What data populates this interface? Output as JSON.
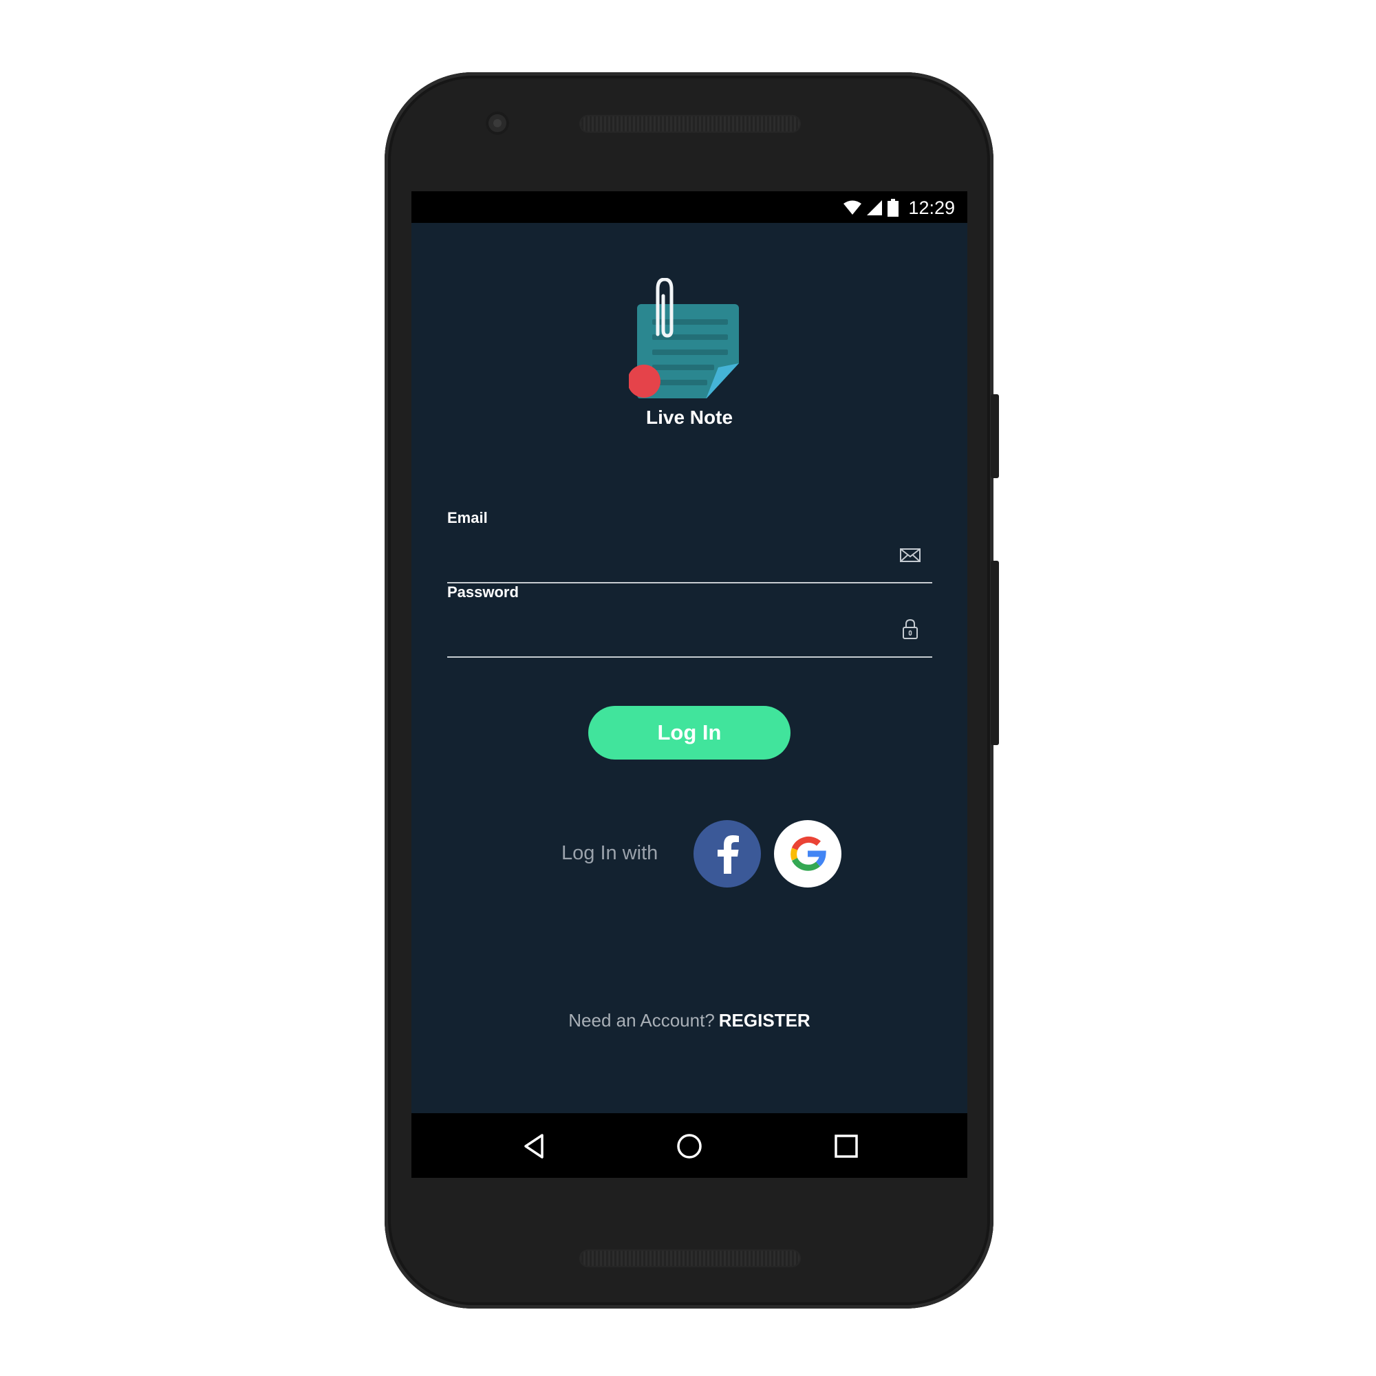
{
  "status_bar": {
    "time": "12:29"
  },
  "app": {
    "name": "Live Note"
  },
  "form": {
    "email": {
      "label": "Email",
      "value": "",
      "placeholder": ""
    },
    "password": {
      "label": "Password",
      "value": "",
      "placeholder": ""
    },
    "login_label": "Log In"
  },
  "social": {
    "label": "Log In with",
    "providers": [
      "facebook",
      "google"
    ]
  },
  "footer": {
    "prompt": "Need an Account?",
    "register_label": "REGISTER"
  },
  "icons": {
    "status": [
      "wifi-icon",
      "cell-signal-icon",
      "battery-icon"
    ],
    "fields": [
      "mail-icon",
      "lock-icon"
    ],
    "nav": [
      "back-icon",
      "home-icon",
      "recents-icon"
    ]
  },
  "colors": {
    "background": "#132230",
    "accent": "#41e49c",
    "facebook": "#3b5998",
    "logo_note": "#2b8790",
    "logo_dot": "#e5434a"
  }
}
